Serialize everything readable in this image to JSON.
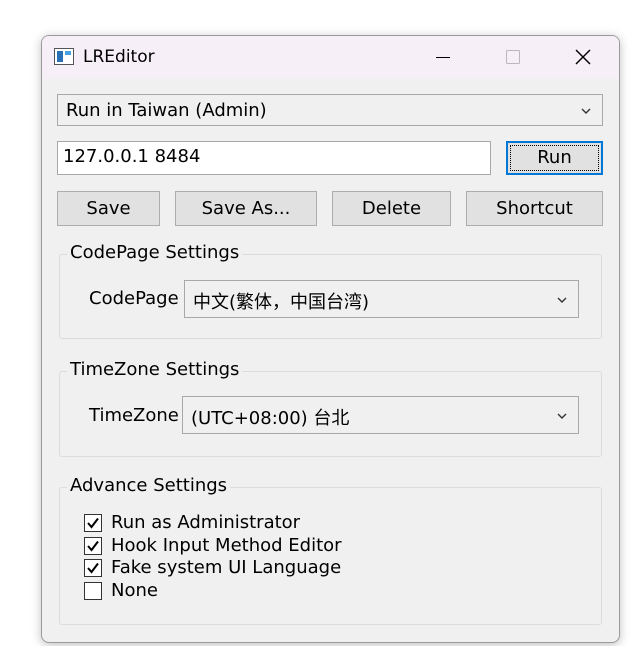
{
  "window": {
    "title": "LREditor",
    "icons": {
      "app": "app-window-icon",
      "minimize": "minimize-icon",
      "maximize": "maximize-icon",
      "close": "close-icon"
    }
  },
  "profile": {
    "selected": "Run in Taiwan (Admin)"
  },
  "command": {
    "value": "127.0.0.1 8484",
    "run_label": "Run"
  },
  "actions": {
    "save": "Save",
    "save_as": "Save As...",
    "delete": "Delete",
    "shortcut": "Shortcut"
  },
  "codepage": {
    "group_title": "CodePage Settings",
    "label": "CodePage",
    "selected": "中文(繁体，中国台湾)"
  },
  "timezone": {
    "group_title": "TimeZone Settings",
    "label": "TimeZone",
    "selected": "(UTC+08:00) 台北"
  },
  "advance": {
    "group_title": "Advance Settings",
    "options": [
      {
        "label": "Run as Administrator",
        "checked": true
      },
      {
        "label": "Hook Input Method Editor",
        "checked": true
      },
      {
        "label": "Fake system UI Language",
        "checked": true
      },
      {
        "label": "None",
        "checked": false
      }
    ]
  }
}
